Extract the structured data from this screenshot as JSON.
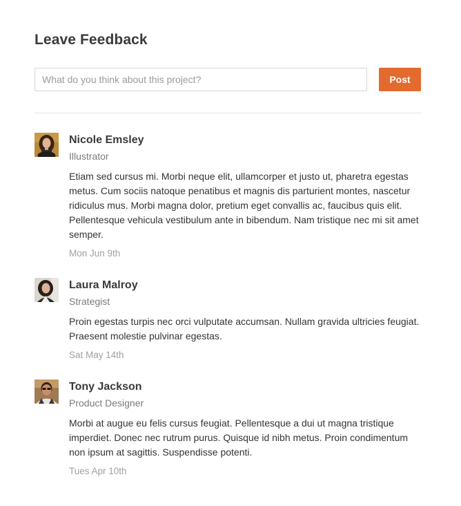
{
  "feedback": {
    "title": "Leave Feedback",
    "input_placeholder": "What do you think about this project?",
    "input_value": "",
    "post_label": "Post"
  },
  "comments": [
    {
      "name": "Nicole Emsley",
      "role": "Illustrator",
      "text": "Etiam sed cursus mi. Morbi neque elit, ullamcorper et justo ut, pharetra egestas metus. Cum sociis natoque penatibus et magnis dis parturient montes, nascetur ridiculus mus. Morbi magna dolor, pretium eget convallis ac, faucibus quis elit. Pellentesque vehicula vestibulum ante in bibendum. Nam tristique nec mi sit amet semper.",
      "date": "Mon Jun 9th",
      "avatar": "avatar-photo-nicole"
    },
    {
      "name": "Laura Malroy",
      "role": "Strategist",
      "text": "Proin egestas turpis nec orci vulputate accumsan. Nullam gravida ultricies feugiat. Praesent molestie pulvinar egestas.",
      "date": "Sat May 14th",
      "avatar": "avatar-photo-laura"
    },
    {
      "name": "Tony Jackson",
      "role": "Product Designer",
      "text": "Morbi at augue eu felis cursus feugiat. Pellentesque a dui ut magna tristique imperdiet. Donec nec rutrum purus. Quisque id nibh metus. Proin condimentum non ipsum at sagittis. Suspendisse potenti.",
      "date": "Tues Apr 10th",
      "avatar": "avatar-photo-tony"
    }
  ],
  "colors": {
    "accent": "#e36b2d",
    "text": "#333333",
    "muted": "#7a7a7a",
    "date": "#a0a0a0",
    "divider": "#e5e5e5"
  }
}
